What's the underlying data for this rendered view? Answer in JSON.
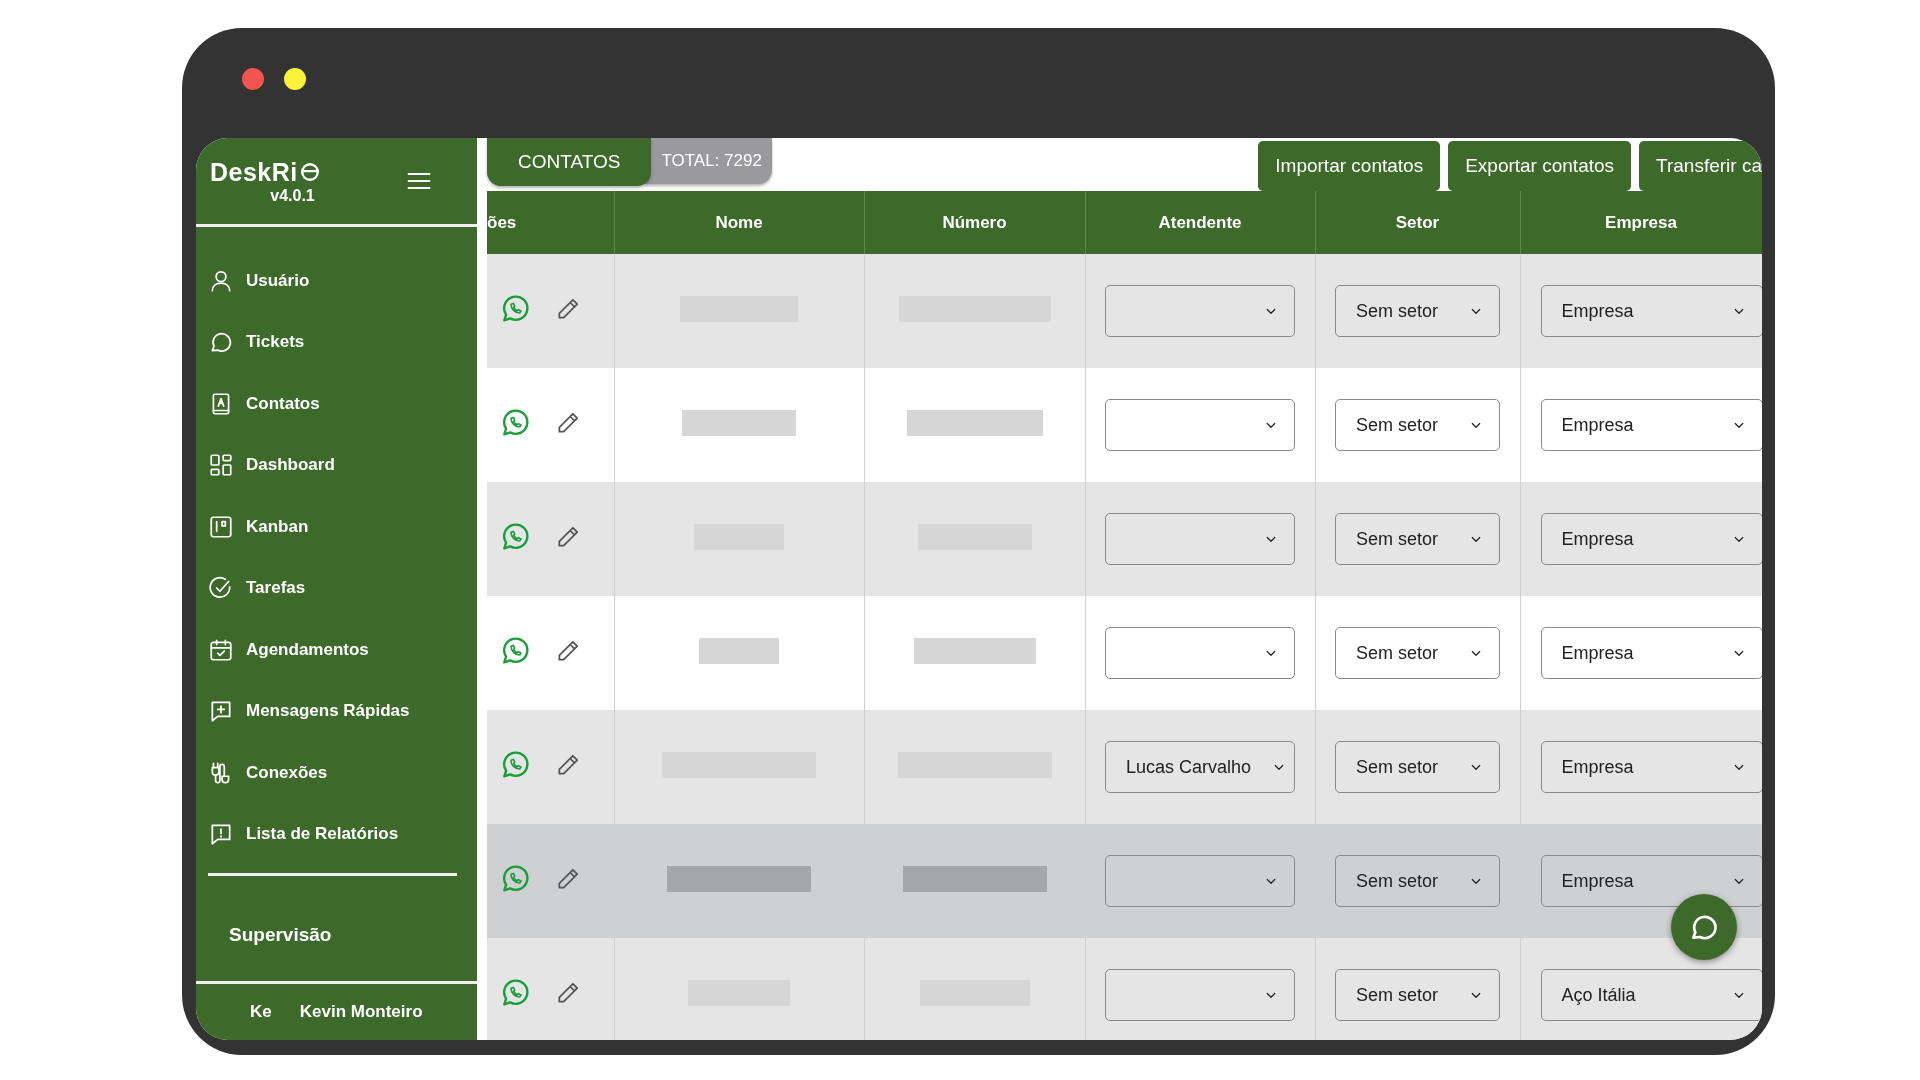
{
  "app": {
    "logo": "DeskRi",
    "version": "v4.0.1"
  },
  "sidebar": {
    "items": [
      {
        "label": "Usuário"
      },
      {
        "label": "Tickets"
      },
      {
        "label": "Contatos"
      },
      {
        "label": "Dashboard"
      },
      {
        "label": "Kanban"
      },
      {
        "label": "Tarefas"
      },
      {
        "label": "Agendamentos"
      },
      {
        "label": "Mensagens Rápidas"
      },
      {
        "label": "Conexões"
      },
      {
        "label": "Lista de Relatórios"
      }
    ],
    "section": "Supervisão",
    "user": {
      "initials": "Ke",
      "name": "Kevin Monteiro"
    }
  },
  "tabs": [
    {
      "label": "CONTATOS",
      "selected": true
    }
  ],
  "total": "TOTAL: 7292",
  "actions": [
    "Importar contatos",
    "Exportar contatos",
    "Transferir ca"
  ],
  "table": {
    "columns": [
      "ões",
      "Nome",
      "Número",
      "Atendente",
      "Setor",
      "Empresa"
    ],
    "rows": [
      {
        "selected": false,
        "setor": "Sem setor",
        "empresa": "Empresa"
      },
      {
        "selected": false,
        "setor": "Sem setor",
        "empresa": "Empresa"
      },
      {
        "selected": false,
        "setor": "Sem setor",
        "empresa": "Empresa"
      },
      {
        "selected": false,
        "setor": "Sem setor",
        "empresa": "Empresa"
      },
      {
        "selected": false,
        "atendente": "Lucas Carvalho",
        "setor": "Sem setor",
        "empresa": "Empresa"
      },
      {
        "selected": true,
        "setor": "Sem setor",
        "empresa": "Empresa"
      },
      {
        "selected": false,
        "setor": "Sem setor",
        "empresa": "Aço Itália"
      }
    ]
  }
}
